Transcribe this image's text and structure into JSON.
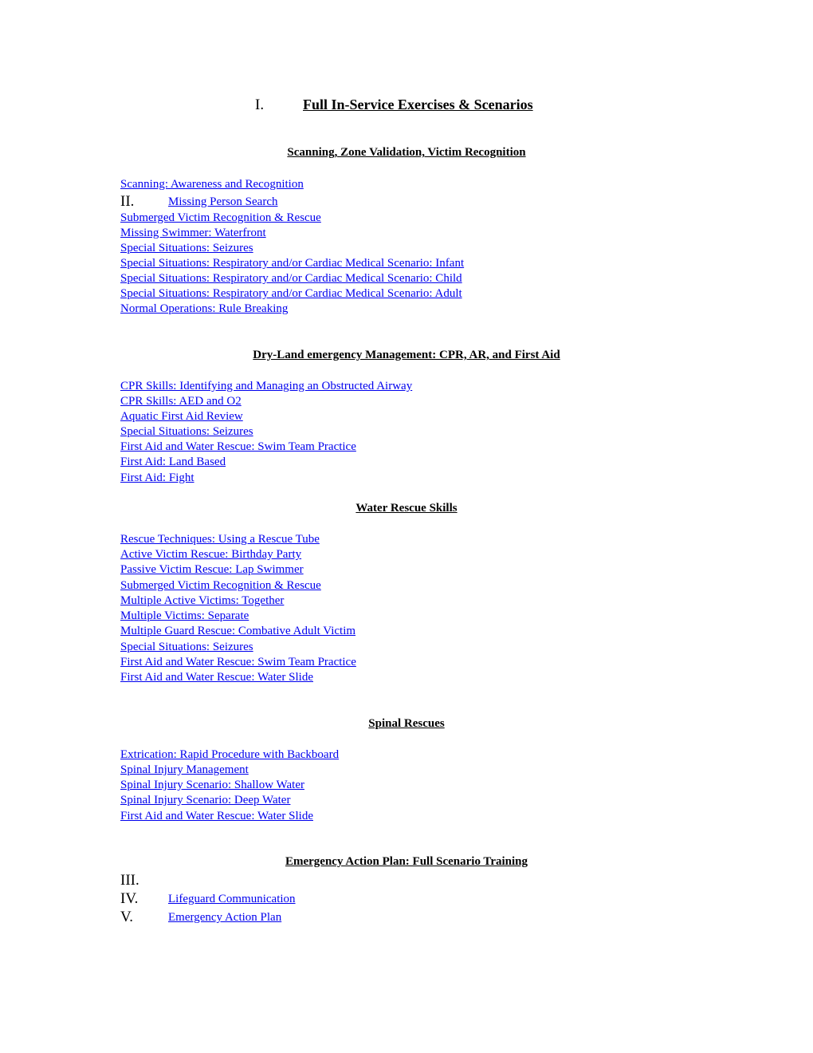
{
  "title": {
    "number": "I.",
    "text": "Full In-Service Exercises & Scenarios"
  },
  "sections": [
    {
      "heading": "Scanning, Zone Validation, Victim Recognition",
      "items": [
        "Scanning: Awareness and Recognition",
        "Missing Person Search",
        "Submerged Victim Recognition & Rescue",
        "Missing Swimmer: Waterfront",
        "Special Situations: Seizures",
        "Special Situations: Respiratory and/or Cardiac Medical Scenario: Infant",
        "Special Situations: Respiratory and/or Cardiac Medical Scenario: Child",
        "Special Situations: Respiratory and/or Cardiac Medical Scenario: Adult",
        "Normal Operations: Rule Breaking"
      ],
      "item_markers": {
        "1": "II."
      }
    },
    {
      "heading": "Dry-Land emergency Management: CPR, AR, and First Aid",
      "items": [
        "CPR Skills: Identifying and Managing an Obstructed Airway",
        "CPR Skills: AED and O2",
        "Aquatic First Aid Review",
        "Special Situations: Seizures",
        "First Aid and Water Rescue: Swim Team Practice",
        "First Aid: Land Based",
        "First Aid: Fight"
      ]
    },
    {
      "heading": "Water Rescue Skills",
      "items": [
        "Rescue Techniques: Using a Rescue Tube",
        "Active Victim Rescue: Birthday Party",
        "Passive Victim Rescue: Lap Swimmer",
        "Submerged Victim Recognition & Rescue",
        "Multiple Active Victims: Together",
        "Multiple Victims: Separate",
        "Multiple Guard Rescue: Combative Adult Victim",
        "Special Situations: Seizures",
        "First Aid and Water Rescue: Swim Team Practice",
        "First Aid and Water Rescue: Water Slide"
      ]
    },
    {
      "heading": "Spinal Rescues",
      "items": [
        "Extrication: Rapid Procedure with Backboard",
        "Spinal Injury Management",
        "Spinal Injury Scenario: Shallow Water",
        "Spinal Injury Scenario: Deep Water",
        "First Aid and Water Rescue: Water Slide"
      ]
    },
    {
      "heading": "Emergency Action Plan: Full Scenario Training",
      "numbered_items": [
        {
          "marker": "III.",
          "label": ""
        },
        {
          "marker": "IV.",
          "label": "Lifeguard Communication"
        },
        {
          "marker": "V.",
          "label": "Emergency Action Plan"
        }
      ]
    }
  ],
  "colors": {
    "link": "#0000ee",
    "text": "#000000",
    "background": "#ffffff"
  }
}
